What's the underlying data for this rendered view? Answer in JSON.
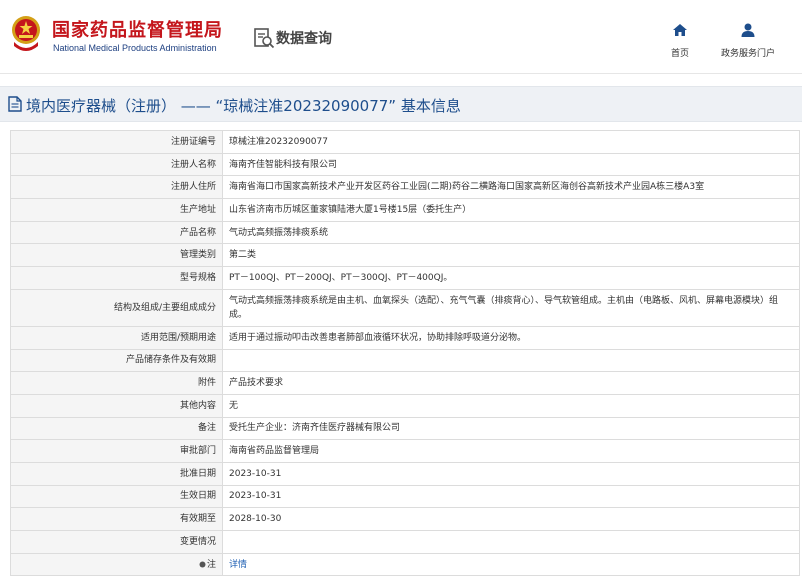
{
  "header": {
    "site_name_cn": "国家药品监督管理局",
    "site_name_en": "National Medical Products Administration",
    "section_title": "数据查询",
    "nav": [
      {
        "label": "首页",
        "icon": "home-icon"
      },
      {
        "label": "政务服务门户",
        "icon": "user-icon"
      }
    ]
  },
  "page": {
    "title": "境内医疗器械（注册） —— “琼械注准20232090077” 基本信息"
  },
  "details": [
    {
      "label": "注册证编号",
      "value": "琼械注准20232090077"
    },
    {
      "label": "注册人名称",
      "value": "海南齐佳智能科技有限公司"
    },
    {
      "label": "注册人住所",
      "value": "海南省海口市国家高新技术产业开发区药谷工业园(二期)药谷二横路海口国家高新区海创谷高新技术产业园A栋三楼A3室"
    },
    {
      "label": "生产地址",
      "value": "山东省济南市历城区董家镇陆港大厦1号楼15层（委托生产）"
    },
    {
      "label": "产品名称",
      "value": "气动式高频振荡排痰系统"
    },
    {
      "label": "管理类别",
      "value": "第二类"
    },
    {
      "label": "型号规格",
      "value": "PT－100QJ、PT－200QJ、PT－300QJ、PT－400QJ。"
    },
    {
      "label": "结构及组成/主要组成成分",
      "value": "气动式高频振荡排痰系统是由主机、血氧探头（选配）、充气气囊（排痰背心）、导气软管组成。主机由（电路板、风机、屏幕电源模块）组成。"
    },
    {
      "label": "适用范围/预期用途",
      "value": "适用于通过振动叩击改善患者肺部血液循环状况，协助排除呼吸道分泌物。"
    },
    {
      "label": "产品储存条件及有效期",
      "value": ""
    },
    {
      "label": "附件",
      "value": "产品技术要求"
    },
    {
      "label": "其他内容",
      "value": "无"
    },
    {
      "label": "备注",
      "value": "受托生产企业：济南齐佳医疗器械有限公司"
    },
    {
      "label": "审批部门",
      "value": "海南省药品监督管理局"
    },
    {
      "label": "批准日期",
      "value": "2023-10-31"
    },
    {
      "label": "生效日期",
      "value": "2023-10-31"
    },
    {
      "label": "有效期至",
      "value": "2028-10-30"
    },
    {
      "label": "变更情况",
      "value": ""
    },
    {
      "label": "注",
      "value": "详情"
    }
  ],
  "colors": {
    "brand_red": "#c4161c",
    "brand_blue": "#1d3f80",
    "title_blue": "#1e4e8c",
    "link_blue": "#1e5fb3"
  }
}
